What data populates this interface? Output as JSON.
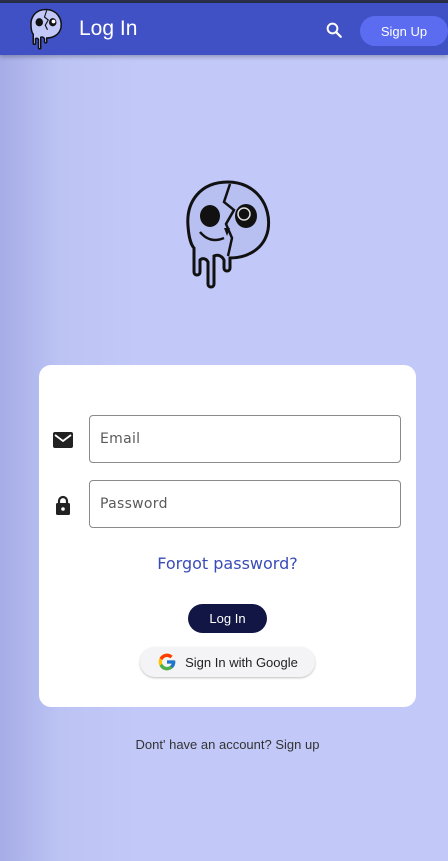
{
  "appbar": {
    "title": "Log In",
    "search_icon": "search-icon",
    "signup_label": "Sign Up",
    "color": "#3f51c4"
  },
  "form": {
    "email": {
      "placeholder": "Email",
      "icon": "mail-icon",
      "value": ""
    },
    "password": {
      "placeholder": "Password",
      "icon": "lock-icon",
      "value": ""
    },
    "forgot_label": "Forgot password?",
    "login_label": "Log In",
    "google_label": "Sign In with Google"
  },
  "footer": {
    "signup_prompt": "Dont' have an account? Sign up"
  },
  "colors": {
    "background": "#c2c9f8",
    "appbar": "#3f51c4",
    "signup_button": "#5c6cf0",
    "login_button": "#121645",
    "link": "#3a4cb8"
  }
}
